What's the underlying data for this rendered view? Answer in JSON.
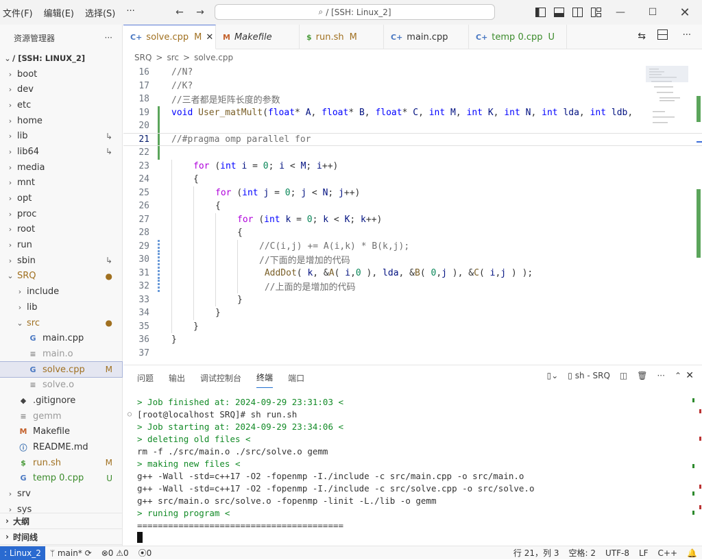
{
  "titlebar": {
    "menus": [
      "文件(F)",
      "编辑(E)",
      "选择(S)",
      "···"
    ],
    "search_text": "/ [SSH: Linux_2]"
  },
  "sidebar": {
    "title": "资源管理器",
    "more": "···",
    "root": "/ [SSH: LINUX_2]",
    "items": [
      {
        "label": "boot",
        "depth": 1,
        "type": "folder",
        "chev": "›"
      },
      {
        "label": "dev",
        "depth": 1,
        "type": "folder",
        "chev": "›"
      },
      {
        "label": "etc",
        "depth": 1,
        "type": "folder",
        "chev": "›"
      },
      {
        "label": "home",
        "depth": 1,
        "type": "folder",
        "chev": "›"
      },
      {
        "label": "lib",
        "depth": 1,
        "type": "folder",
        "chev": "›",
        "badge": "↳"
      },
      {
        "label": "lib64",
        "depth": 1,
        "type": "folder",
        "chev": "›",
        "badge": "↳"
      },
      {
        "label": "media",
        "depth": 1,
        "type": "folder",
        "chev": "›"
      },
      {
        "label": "mnt",
        "depth": 1,
        "type": "folder",
        "chev": "›"
      },
      {
        "label": "opt",
        "depth": 1,
        "type": "folder",
        "chev": "›"
      },
      {
        "label": "proc",
        "depth": 1,
        "type": "folder",
        "chev": "›"
      },
      {
        "label": "root",
        "depth": 1,
        "type": "folder",
        "chev": "›"
      },
      {
        "label": "run",
        "depth": 1,
        "type": "folder",
        "chev": "›"
      },
      {
        "label": "sbin",
        "depth": 1,
        "type": "folder",
        "chev": "›",
        "badge": "↳"
      },
      {
        "label": "SRQ",
        "depth": 1,
        "type": "folder-open",
        "chev": "⌄",
        "badge": "●",
        "color": "#a07020"
      },
      {
        "label": "include",
        "depth": 2,
        "type": "folder",
        "chev": "›"
      },
      {
        "label": "lib",
        "depth": 2,
        "type": "folder",
        "chev": "›"
      },
      {
        "label": "src",
        "depth": 2,
        "type": "folder-open",
        "chev": "⌄",
        "badge": "●",
        "color": "#a07020"
      },
      {
        "label": "main.cpp",
        "depth": 3,
        "type": "cpp"
      },
      {
        "label": "main.o",
        "depth": 3,
        "type": "obj",
        "color": "#999"
      },
      {
        "label": "solve.cpp",
        "depth": 3,
        "type": "cpp",
        "badge": "M",
        "color": "#a07020",
        "selected": true
      },
      {
        "label": "solve.o",
        "depth": 3,
        "type": "obj",
        "color": "#999"
      },
      {
        "label": ".gitignore",
        "depth": 2,
        "type": "git"
      },
      {
        "label": "gemm",
        "depth": 2,
        "type": "plain",
        "color": "#999"
      },
      {
        "label": "Makefile",
        "depth": 2,
        "type": "make"
      },
      {
        "label": "README.md",
        "depth": 2,
        "type": "info"
      },
      {
        "label": "run.sh",
        "depth": 2,
        "type": "sh",
        "badge": "M",
        "color": "#a07020"
      },
      {
        "label": "temp 0.cpp",
        "depth": 2,
        "type": "cpp",
        "badge": "U",
        "color": "#3a8a2a"
      },
      {
        "label": "srv",
        "depth": 1,
        "type": "folder",
        "chev": "›"
      },
      {
        "label": "sys",
        "depth": 1,
        "type": "folder",
        "chev": "›"
      }
    ],
    "outline": "大纲",
    "timeline": "时间线"
  },
  "tabs": [
    {
      "icon": "C+",
      "label": "solve.cpp",
      "badge": "M",
      "active": true,
      "close": "✕"
    },
    {
      "icon": "M",
      "label": "Makefile",
      "italic": true
    },
    {
      "icon": "$",
      "label": "run.sh",
      "badge": "M"
    },
    {
      "icon": "C+",
      "label": "main.cpp"
    },
    {
      "icon": "C+",
      "label": "temp 0.cpp",
      "badge": "U"
    }
  ],
  "breadcrumb": [
    "SRQ",
    ">",
    "src",
    ">",
    "solve.cpp"
  ],
  "code": [
    {
      "n": "16",
      "s": [
        [
          "c",
          "//N?"
        ]
      ]
    },
    {
      "n": "17",
      "s": [
        [
          "c",
          "//K?"
        ]
      ]
    },
    {
      "n": "18",
      "s": [
        [
          "c",
          "//三者都是矩阵长度的参数"
        ]
      ]
    },
    {
      "n": "19",
      "s": [
        [
          "t",
          "void "
        ],
        [
          "f",
          "User_matMult"
        ],
        [
          "p",
          "("
        ],
        [
          "t",
          "float"
        ],
        [
          "p",
          "* "
        ],
        [
          "v",
          "A"
        ],
        [
          "p",
          ", "
        ],
        [
          "t",
          "float"
        ],
        [
          "p",
          "* "
        ],
        [
          "v",
          "B"
        ],
        [
          "p",
          ", "
        ],
        [
          "t",
          "float"
        ],
        [
          "p",
          "* "
        ],
        [
          "v",
          "C"
        ],
        [
          "p",
          ", "
        ],
        [
          "t",
          "int "
        ],
        [
          "v",
          "M"
        ],
        [
          "p",
          ", "
        ],
        [
          "t",
          "int "
        ],
        [
          "v",
          "K"
        ],
        [
          "p",
          ", "
        ],
        [
          "t",
          "int "
        ],
        [
          "v",
          "N"
        ],
        [
          "p",
          ", "
        ],
        [
          "t",
          "int "
        ],
        [
          "v",
          "lda"
        ],
        [
          "p",
          ", "
        ],
        [
          "t",
          "int "
        ],
        [
          "v",
          "ldb"
        ],
        [
          "p",
          ", "
        ]
      ]
    },
    {
      "n": "20",
      "s": []
    },
    {
      "n": "21",
      "s": [
        [
          "c",
          "//#pragma omp parallel for"
        ]
      ],
      "cur": true
    },
    {
      "n": "22",
      "s": []
    },
    {
      "n": "23",
      "ind": 1,
      "s": [
        [
          "ctl",
          "for "
        ],
        [
          "p",
          "("
        ],
        [
          "t",
          "int "
        ],
        [
          "v",
          "i"
        ],
        [
          "p",
          " = "
        ],
        [
          "n",
          "0"
        ],
        [
          "p",
          "; "
        ],
        [
          "v",
          "i"
        ],
        [
          "p",
          " < "
        ],
        [
          "v",
          "M"
        ],
        [
          "p",
          "; "
        ],
        [
          "v",
          "i"
        ],
        [
          "p",
          "++)"
        ]
      ]
    },
    {
      "n": "24",
      "ind": 1,
      "s": [
        [
          "p",
          "{"
        ]
      ]
    },
    {
      "n": "25",
      "ind": 2,
      "s": [
        [
          "ctl",
          "for "
        ],
        [
          "p",
          "("
        ],
        [
          "t",
          "int "
        ],
        [
          "v",
          "j"
        ],
        [
          "p",
          " = "
        ],
        [
          "n",
          "0"
        ],
        [
          "p",
          "; "
        ],
        [
          "v",
          "j"
        ],
        [
          "p",
          " < "
        ],
        [
          "v",
          "N"
        ],
        [
          "p",
          "; "
        ],
        [
          "v",
          "j"
        ],
        [
          "p",
          "++)"
        ]
      ]
    },
    {
      "n": "26",
      "ind": 2,
      "s": [
        [
          "p",
          "{"
        ]
      ]
    },
    {
      "n": "27",
      "ind": 3,
      "s": [
        [
          "ctl",
          "for "
        ],
        [
          "p",
          "("
        ],
        [
          "t",
          "int "
        ],
        [
          "v",
          "k"
        ],
        [
          "p",
          " = "
        ],
        [
          "n",
          "0"
        ],
        [
          "p",
          "; "
        ],
        [
          "v",
          "k"
        ],
        [
          "p",
          " < "
        ],
        [
          "v",
          "K"
        ],
        [
          "p",
          "; "
        ],
        [
          "v",
          "k"
        ],
        [
          "p",
          "++)"
        ]
      ]
    },
    {
      "n": "28",
      "ind": 3,
      "s": [
        [
          "p",
          "{"
        ]
      ]
    },
    {
      "n": "29",
      "ind": 4,
      "s": [
        [
          "c",
          "//C(i,j) += A(i,k) * B(k,j);"
        ]
      ]
    },
    {
      "n": "30",
      "ind": 4,
      "s": [
        [
          "c",
          "//下面的是增加的代码"
        ]
      ]
    },
    {
      "n": "31",
      "ind": 4,
      "s": [
        [
          "f",
          " AddDot"
        ],
        [
          "p",
          "( "
        ],
        [
          "v",
          "k"
        ],
        [
          "p",
          ", &"
        ],
        [
          "f",
          "A"
        ],
        [
          "p",
          "( "
        ],
        [
          "v",
          "i"
        ],
        [
          "p",
          ","
        ],
        [
          "n",
          "0"
        ],
        [
          "p",
          " ), "
        ],
        [
          "v",
          "lda"
        ],
        [
          "p",
          ", &"
        ],
        [
          "f",
          "B"
        ],
        [
          "p",
          "( "
        ],
        [
          "n",
          "0"
        ],
        [
          "p",
          ","
        ],
        [
          "v",
          "j"
        ],
        [
          "p",
          " ), &"
        ],
        [
          "f",
          "C"
        ],
        [
          "p",
          "( "
        ],
        [
          "v",
          "i"
        ],
        [
          "p",
          ","
        ],
        [
          "v",
          "j"
        ],
        [
          "p",
          " ) );"
        ]
      ]
    },
    {
      "n": "32",
      "ind": 4,
      "s": [
        [
          "c",
          " //上面的是增加的代码"
        ]
      ]
    },
    {
      "n": "33",
      "ind": 3,
      "s": [
        [
          "p",
          "}"
        ]
      ]
    },
    {
      "n": "34",
      "ind": 2,
      "s": [
        [
          "p",
          "}"
        ]
      ]
    },
    {
      "n": "35",
      "ind": 1,
      "s": [
        [
          "p",
          "}"
        ]
      ]
    },
    {
      "n": "36",
      "s": [
        [
          "p",
          "}"
        ]
      ]
    },
    {
      "n": "37",
      "s": []
    }
  ],
  "panel": {
    "tabs": [
      "问题",
      "输出",
      "调试控制台",
      "终端",
      "端口"
    ],
    "terminal_name": "sh - SRQ",
    "lines": [
      {
        "t": "> Job finished at: 2024-09-29 23:31:03 <",
        "g": true
      },
      {
        "t": "[root@localhost SRQ]# sh run.sh",
        "prompt": true
      },
      {
        "t": "> Job starting at: 2024-09-29 23:34:06 <",
        "g": true
      },
      {
        "t": "> deleting old files <",
        "g": true
      },
      {
        "t": "rm -f ./src/main.o ./src/solve.o gemm"
      },
      {
        "t": "> making new files <",
        "g": true
      },
      {
        "t": "g++ -Wall -std=c++17 -O2 -fopenmp -I./include -c src/main.cpp -o src/main.o"
      },
      {
        "t": "g++ -Wall -std=c++17 -O2 -fopenmp -I./include -c src/solve.cpp -o src/solve.o"
      },
      {
        "t": "g++ src/main.o src/solve.o -fopenmp -linit -L./lib -o gemm"
      },
      {
        "t": "> runing program <",
        "g": true
      },
      {
        "t": "========================================"
      }
    ]
  },
  "status": {
    "remote": ": Linux_2",
    "branch": "main*",
    "errors": "0",
    "warnings": "0",
    "ports": "0",
    "position": "行 21，列 3",
    "spaces": "空格: 2",
    "encoding": "UTF-8",
    "eol": "LF",
    "lang": "C++"
  }
}
